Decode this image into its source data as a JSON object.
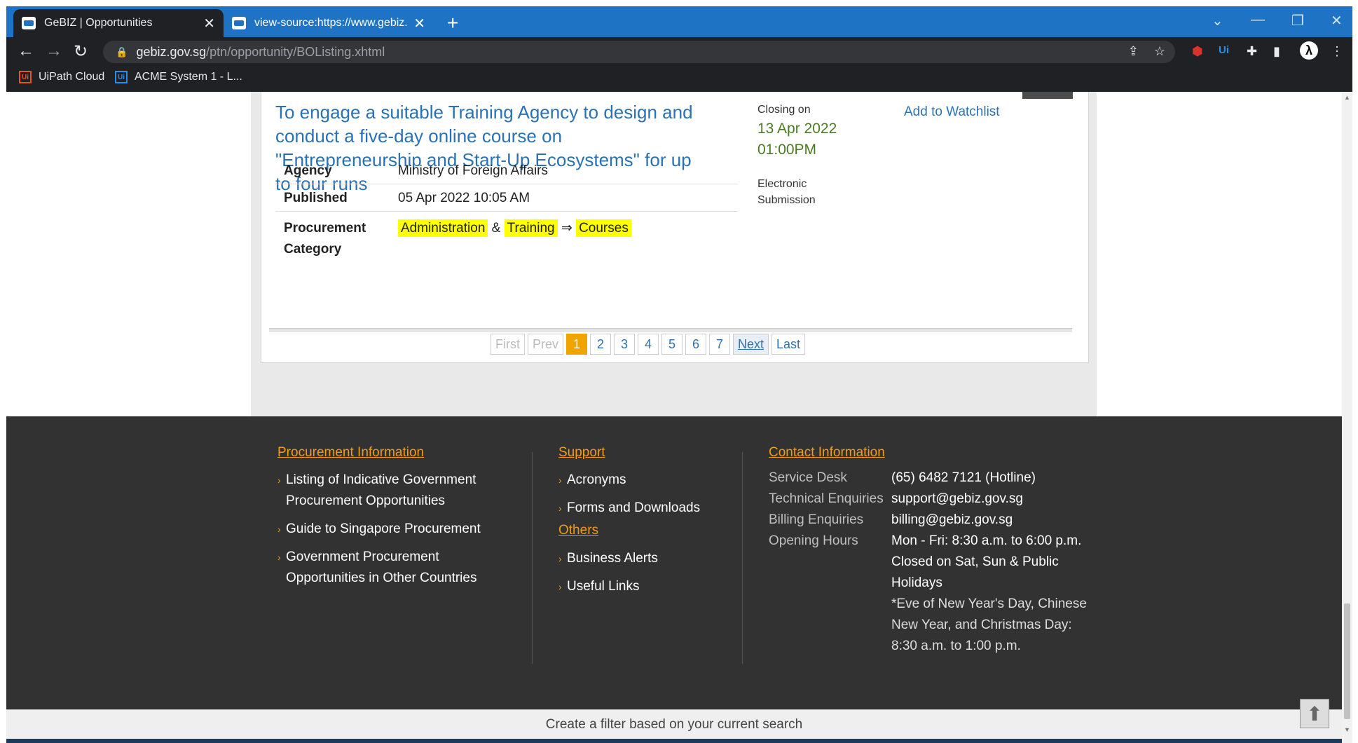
{
  "browser": {
    "tabs": [
      {
        "title": "GeBIZ | Opportunities",
        "active": true
      },
      {
        "title": "view-source:https://www.gebiz.g",
        "active": false
      }
    ],
    "url_host": "gebiz.gov.sg",
    "url_path": "/ptn/opportunity/BOListing.xhtml",
    "bookmarks": [
      {
        "label": "UiPath Cloud",
        "color": "#e8542a"
      },
      {
        "label": "ACME System 1 - L...",
        "color": "#2a8ee8"
      }
    ]
  },
  "opportunity": {
    "title": "To engage a suitable Training Agency to design and conduct a five-day online course on \"Entrepreneurship and Start-Up Ecosystems\" for up to four runs",
    "closing_label": "Closing on",
    "closing_date": "13 Apr 2022",
    "closing_time": "01:00PM",
    "submission_line1": "Electronic",
    "submission_line2": "Submission",
    "watchlist": "Add to Watchlist",
    "agency_label": "Agency",
    "agency": "Ministry of Foreign Affairs",
    "published_label": "Published",
    "published": "05 Apr 2022 10:05 AM",
    "category_label_1": "Procurement",
    "category_label_2": "Category",
    "category_1": "Administration",
    "category_amp": "&",
    "category_2": "Training",
    "category_arrow": "⇒",
    "category_3": "Courses"
  },
  "pagination": {
    "first": "First",
    "prev": "Prev",
    "pages": [
      "1",
      "2",
      "3",
      "4",
      "5",
      "6",
      "7"
    ],
    "current": "1",
    "next": "Next",
    "last": "Last"
  },
  "footer": {
    "proc_heading": "Procurement Information",
    "proc_links": [
      [
        "Listing of Indicative Government",
        "Procurement Opportunities"
      ],
      [
        "Guide to Singapore Procurement"
      ],
      [
        "Government Procurement",
        "Opportunities in Other Countries"
      ]
    ],
    "support_heading": "Support",
    "support_links": [
      "Acronyms",
      "Forms and Downloads"
    ],
    "others_heading": "Others",
    "others_links": [
      "Business Alerts",
      "Useful Links"
    ],
    "contact_heading": "Contact Information",
    "contact": {
      "service_desk_label": "Service Desk",
      "service_desk": "(65) 6482 7121 (Hotline)",
      "tech_label": "Technical Enquiries",
      "tech": "support@gebiz.gov.sg",
      "billing_label": "Billing Enquiries",
      "billing": "billing@gebiz.gov.sg",
      "hours_label": "Opening Hours",
      "hours_1": "Mon - Fri: 8:30 a.m. to 6:00 p.m.",
      "hours_2": "Closed on Sat, Sun & Public",
      "hours_3": "Holidays",
      "note_1": "*Eve of New Year's Day, Chinese",
      "note_2": "New Year, and Christmas Day:",
      "note_3": "8:30 a.m. to 1:00 p.m."
    }
  },
  "filter_bar": "Create a filter based on your current search",
  "colors": {
    "link": "#2a72b5",
    "accent": "#f0a400",
    "highlight": "#ffff00",
    "footer_bg": "#323232"
  }
}
